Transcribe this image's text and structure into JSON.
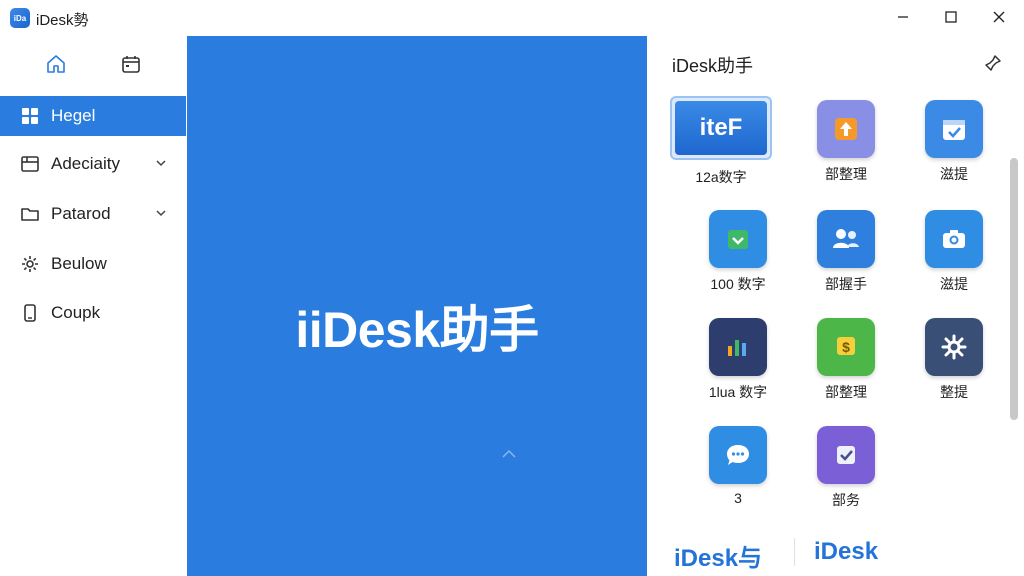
{
  "window": {
    "title": "iDesk勢",
    "logo_text": "iDa"
  },
  "sidebar": {
    "top_icons": [
      "home-icon",
      "calendar-icon"
    ],
    "items": [
      {
        "label": "Hegel",
        "icon": "grid-icon",
        "active": true
      },
      {
        "label": "Adeciaity",
        "icon": "folder-box-icon",
        "expandable": true
      },
      {
        "label": "Patarod",
        "icon": "folder-icon",
        "expandable": true
      },
      {
        "label": "Beulow",
        "icon": "gear-icon"
      },
      {
        "label": "Coupk",
        "icon": "phone-icon"
      }
    ]
  },
  "splash": {
    "title": "iiDesk助手"
  },
  "panel": {
    "header": "iDesk助手",
    "featured": {
      "label": "iteF",
      "caption": "12a数字"
    },
    "tiles": [
      {
        "label": "部整理",
        "icon": "upload-icon"
      },
      {
        "label": "滋提",
        "icon": "calendar-check-icon"
      },
      {
        "label": "100 数字",
        "icon": "download-box-icon"
      },
      {
        "label": "部握手",
        "icon": "users-icon"
      },
      {
        "label": "滋提",
        "icon": "camera-icon"
      },
      {
        "label": "1lua 数字",
        "icon": "chart-icon"
      },
      {
        "label": "部整理",
        "icon": "dollar-icon"
      },
      {
        "label": "整提",
        "icon": "gear-icon"
      },
      {
        "label": "3",
        "icon": "chat-icon"
      },
      {
        "label": "部务",
        "icon": "checkbox-icon"
      }
    ],
    "footer": {
      "left": "iDesk与",
      "right": "iDesk"
    }
  },
  "colors": {
    "accent": "#2a7ddf",
    "brand_text": "#2373d8"
  }
}
